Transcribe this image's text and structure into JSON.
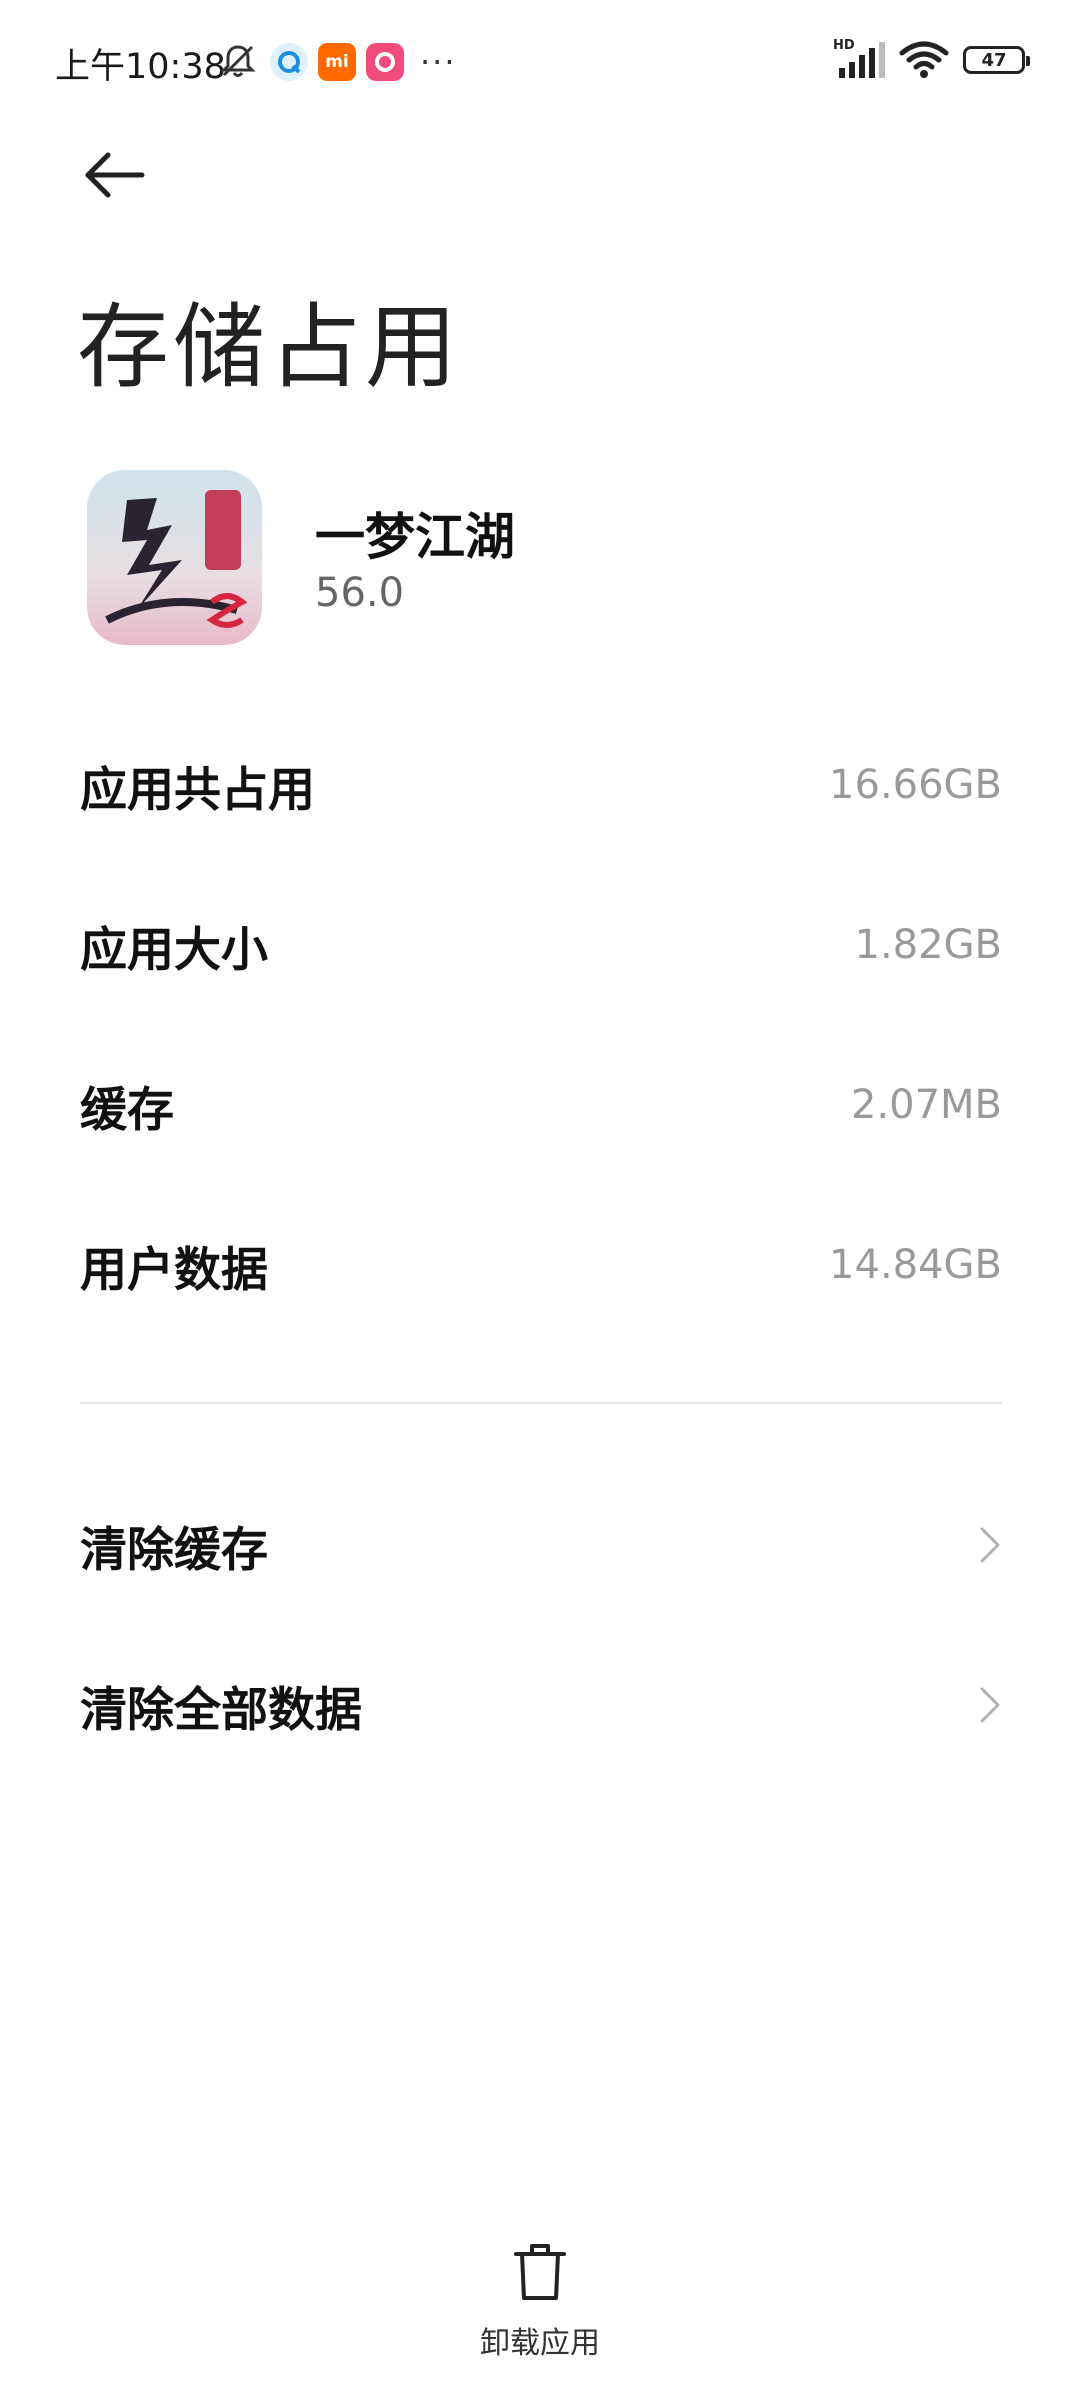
{
  "status_bar": {
    "time": "上午10:38",
    "mi_label": "mi",
    "more": "···",
    "hd": "HD",
    "battery": "47"
  },
  "header": {
    "title": "存储占用"
  },
  "app": {
    "name": "一梦江湖",
    "version": "56.0"
  },
  "storage": [
    {
      "label": "应用共占用",
      "value": "16.66GB"
    },
    {
      "label": "应用大小",
      "value": "1.82GB"
    },
    {
      "label": "缓存",
      "value": "2.07MB"
    },
    {
      "label": "用户数据",
      "value": "14.84GB"
    }
  ],
  "actions": [
    {
      "label": "清除缓存"
    },
    {
      "label": "清除全部数据"
    }
  ],
  "footer": {
    "uninstall_label": "卸载应用"
  },
  "colors": {
    "background": "#ffffff",
    "value_gray": "#9a9a9a",
    "divider": "#e6e6e6"
  }
}
